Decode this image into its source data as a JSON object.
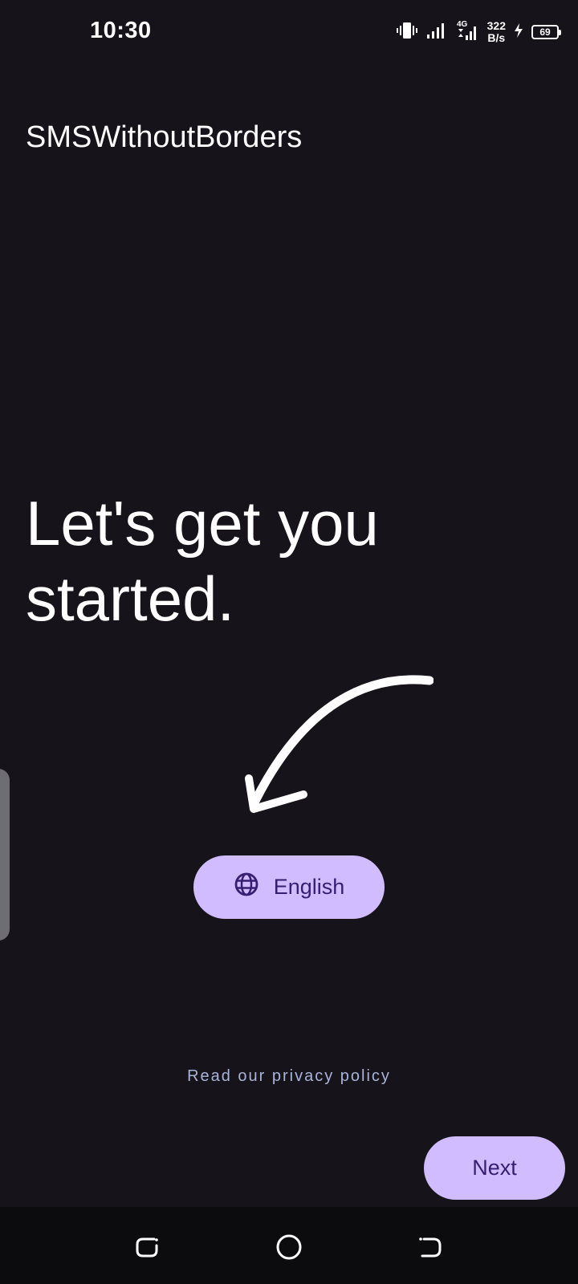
{
  "status_bar": {
    "time": "10:30",
    "network_type": "4G",
    "net_speed_value": "322",
    "net_speed_unit": "B/s",
    "battery_level": "69",
    "icons": [
      "vibrate-icon",
      "signal-icon",
      "signal-4g-icon",
      "charging-icon",
      "battery-icon"
    ]
  },
  "app": {
    "title": "SMSWithoutBorders"
  },
  "onboarding": {
    "headline": "Let's get you started.",
    "language_button_label": "English",
    "language_icon": "globe-icon",
    "privacy_link": "Read our privacy policy",
    "next_label": "Next"
  },
  "nav_bar": {
    "icons": [
      "recents-icon",
      "home-icon",
      "back-icon"
    ]
  },
  "colors": {
    "background": "#16131b",
    "accent": "#d0bcff",
    "on_accent": "#381e72",
    "link": "#a8b4d8"
  }
}
